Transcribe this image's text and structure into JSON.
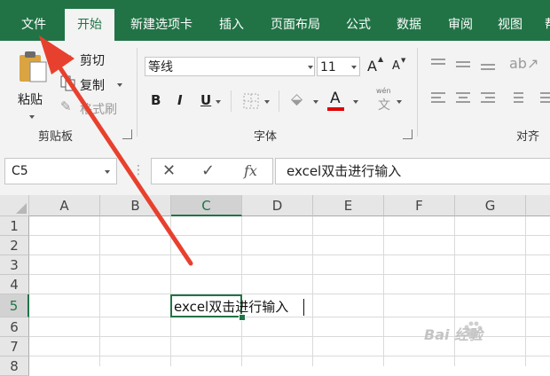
{
  "tabs": [
    "文件",
    "开始",
    "新建选项卡",
    "插入",
    "页面布局",
    "公式",
    "数据",
    "审阅",
    "视图",
    "帮"
  ],
  "active_tab": "开始",
  "clipboard": {
    "paste_label": "粘贴",
    "cut_label": "剪切",
    "copy_label": "复制",
    "format_painter_label": "格式刷",
    "group_label": "剪贴板"
  },
  "font": {
    "font_name": "等线",
    "font_size": "11",
    "bold": "B",
    "italic": "I",
    "underline": "U",
    "font_color_letter": "A",
    "grow_font": "A",
    "shrink_font": "A",
    "wen_label": "文",
    "group_label": "字体"
  },
  "alignment": {
    "group_label": "对齐方"
  },
  "formula_bar": {
    "name_box": "C5",
    "cancel_symbol": "✕",
    "enter_symbol": "✓",
    "fx_symbol": "fx",
    "content": "excel双击进行输入"
  },
  "grid": {
    "columns": [
      "A",
      "B",
      "C",
      "D",
      "E",
      "F",
      "G"
    ],
    "rows": [
      "1",
      "2",
      "3",
      "4",
      "5",
      "6",
      "7",
      "8"
    ],
    "selected_column": "C",
    "selected_row": "5",
    "active_cell_text": "excel双击进行输入"
  },
  "watermark": "Bai 经验",
  "colors": {
    "excel_green": "#217346",
    "arrow_red": "#e8402e",
    "font_color_bar": "#e00000"
  }
}
